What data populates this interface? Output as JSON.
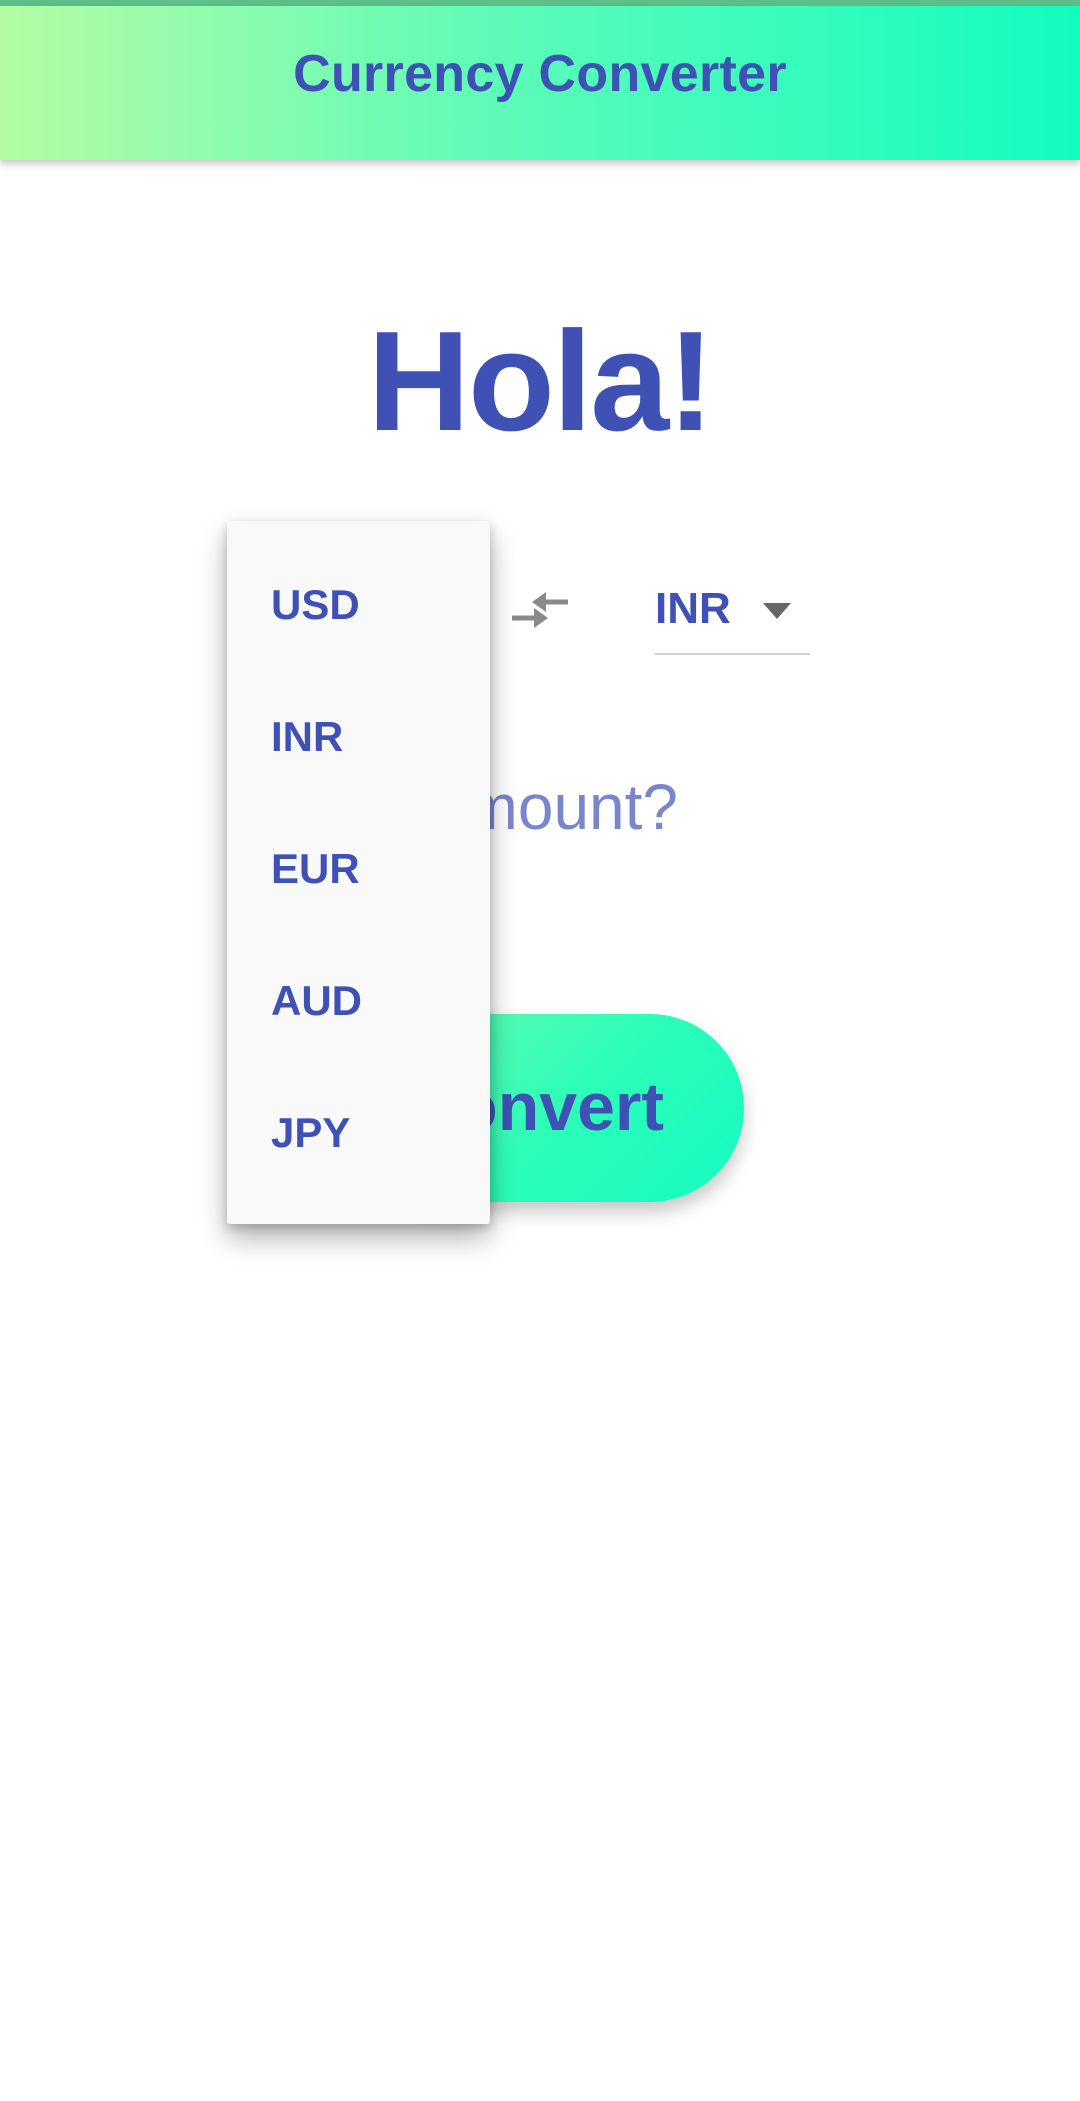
{
  "app_bar": {
    "title": "Currency Converter"
  },
  "greeting": "Hola!",
  "from_currency": {
    "selected": "USD"
  },
  "to_currency": {
    "selected": "INR"
  },
  "amount_input": {
    "placeholder": "Amount?"
  },
  "convert_button": {
    "label": "Convert"
  },
  "dropdown": {
    "options": [
      "USD",
      "INR",
      "EUR",
      "AUD",
      "JPY"
    ]
  },
  "colors": {
    "primary_text": "#3f51b5",
    "accent_gradient_start": "#b4fca4",
    "accent_gradient_end": "#12fcc0"
  },
  "icons": {
    "swap": "swap-arrows-icon",
    "caret": "caret-down-icon"
  }
}
